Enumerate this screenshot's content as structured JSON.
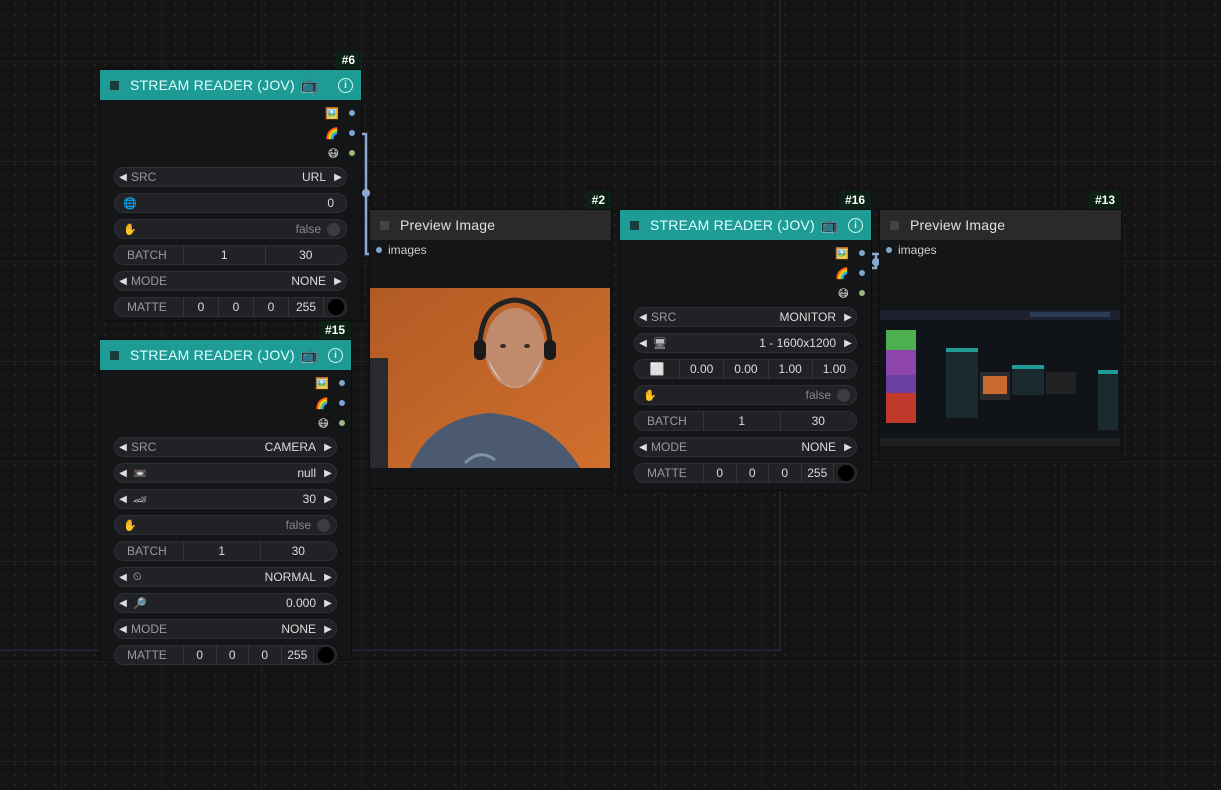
{
  "nodes": {
    "n6": {
      "id": "#6",
      "title": "STREAM READER (JOV)",
      "outputs": [
        "🖼️",
        "🌈",
        "😷"
      ],
      "src": {
        "label": "SRC",
        "value": "URL"
      },
      "url_value": "0",
      "pause": "false",
      "batch": {
        "label": "BATCH",
        "a": "1",
        "b": "30"
      },
      "mode": {
        "label": "MODE",
        "value": "NONE"
      },
      "matte": {
        "label": "MATTE",
        "r": "0",
        "g": "0",
        "b": "0",
        "a": "255"
      }
    },
    "n15": {
      "id": "#15",
      "title": "STREAM READER (JOV)",
      "outputs": [
        "🖼️",
        "🌈",
        "😷"
      ],
      "src": {
        "label": "SRC",
        "value": "CAMERA"
      },
      "device": "null",
      "fps": "30",
      "pause": "false",
      "batch": {
        "label": "BATCH",
        "a": "1",
        "b": "30"
      },
      "timer": "NORMAL",
      "zoom": "0.000",
      "mode": {
        "label": "MODE",
        "value": "NONE"
      },
      "matte": {
        "label": "MATTE",
        "r": "0",
        "g": "0",
        "b": "0",
        "a": "255"
      }
    },
    "n2": {
      "id": "#2",
      "title": "Preview Image",
      "input": "images"
    },
    "n16": {
      "id": "#16",
      "title": "STREAM READER (JOV)",
      "outputs": [
        "🖼️",
        "🌈",
        "😷"
      ],
      "src": {
        "label": "SRC",
        "value": "MONITOR"
      },
      "monitor": "1 - 1600x1200",
      "region": [
        "0.00",
        "0.00",
        "1.00",
        "1.00"
      ],
      "pause": "false",
      "batch": {
        "label": "BATCH",
        "a": "1",
        "b": "30"
      },
      "mode": {
        "label": "MODE",
        "value": "NONE"
      },
      "matte": {
        "label": "MATTE",
        "r": "0",
        "g": "0",
        "b": "0",
        "a": "255"
      }
    },
    "n13": {
      "id": "#13",
      "title": "Preview Image",
      "input": "images"
    }
  },
  "colors": {
    "header_teal": "#1f9b95",
    "header_gray": "#2a2a2a",
    "link_blue": "#7da7d0",
    "link_green": "#9ab87c"
  }
}
